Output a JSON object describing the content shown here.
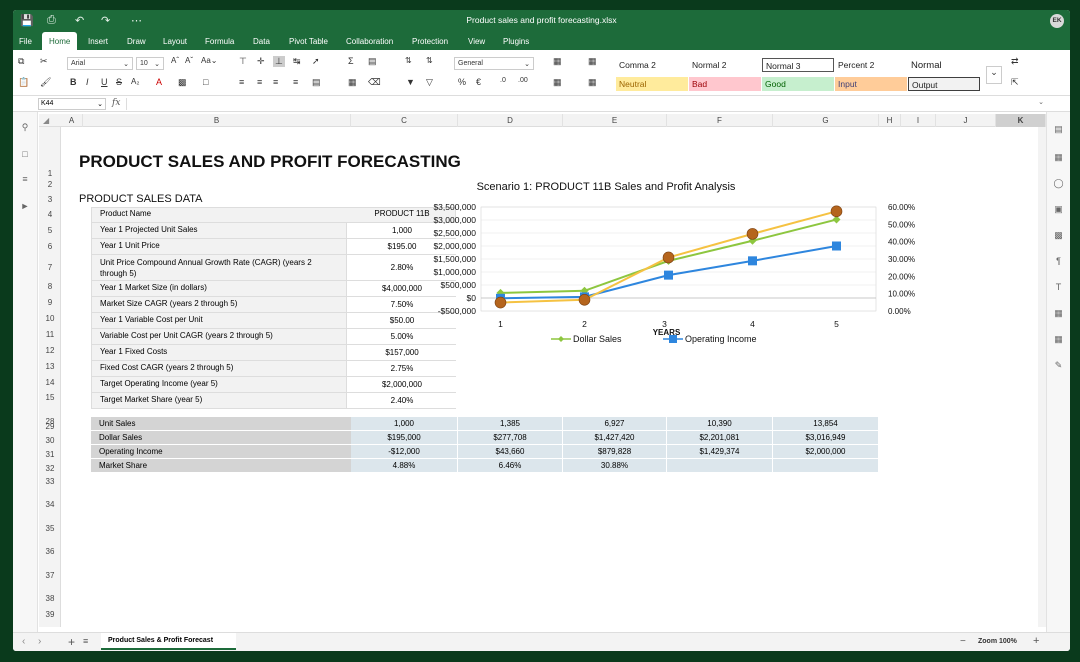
{
  "window": {
    "title": "Product sales and profit forecasting.xlsx",
    "avatar": "EK"
  },
  "menu": {
    "tabs": [
      "File",
      "Home",
      "Insert",
      "Draw",
      "Layout",
      "Formula",
      "Data",
      "Pivot Table",
      "Collaboration",
      "Protection",
      "View",
      "Plugins"
    ],
    "active": "Home"
  },
  "ribbon": {
    "font": "Arial",
    "size": "10",
    "number_format": "General",
    "styles_top": [
      "Comma 2",
      "Normal 2",
      "Normal 3",
      "Percent 2",
      "Normal"
    ],
    "styles_bottom": [
      "Neutral",
      "Bad",
      "Good",
      "Input",
      "Output"
    ],
    "style_colors": {
      "Neutral": "#ffeb9c",
      "Bad": "#ffc7ce",
      "Good": "#c6efce",
      "Input": "#ffcc99",
      "Output": "#f2f2f2"
    }
  },
  "formula_bar": {
    "cell_ref": "K44",
    "fx": "fx",
    "value": ""
  },
  "columns": [
    "A",
    "B",
    "C",
    "D",
    "E",
    "F",
    "G",
    "H",
    "I",
    "J",
    "K"
  ],
  "rows": [
    "1",
    "2",
    "3",
    "4",
    "5",
    "6",
    "7",
    "8",
    "9",
    "10",
    "11",
    "12",
    "13",
    "14",
    "15",
    "28",
    "29",
    "30",
    "31",
    "32",
    "33",
    "34",
    "35",
    "36",
    "37",
    "38",
    "39"
  ],
  "sheet": {
    "title": "PRODUCT SALES AND PROFIT FORECASTING",
    "section": "PRODUCT SALES DATA",
    "table_header": {
      "label": "Product Name",
      "value": "PRODUCT 11B"
    },
    "inputs": [
      {
        "label": "Year 1 Projected Unit Sales",
        "value": "1,000"
      },
      {
        "label": "Year 1 Unit Price",
        "value": "$195.00"
      },
      {
        "label": "Unit Price Compound Annual Growth Rate (CAGR) (years 2",
        "label2": "through 5)",
        "value": "2.80%"
      },
      {
        "label": "Year 1 Market Size (in dollars)",
        "value": "$4,000,000"
      },
      {
        "label": "Market Size CAGR (years 2 through 5)",
        "value": "7.50%"
      },
      {
        "label": "Year 1 Variable Cost per Unit",
        "value": "$50.00"
      },
      {
        "label": "Variable Cost per Unit CAGR (years 2 through 5)",
        "value": "5.00%"
      },
      {
        "label": "Year 1 Fixed Costs",
        "value": "$157,000"
      },
      {
        "label": "Fixed Cost CAGR (years 2 through 5)",
        "value": "2.75%"
      },
      {
        "label": "Target Operating Income (year 5)",
        "value": "$2,000,000"
      },
      {
        "label": "Target Market Share (year 5)",
        "value": "2.40%"
      }
    ],
    "summary": [
      {
        "label": "Unit Sales",
        "values": [
          "1,000",
          "1,385",
          "6,927",
          "10,390",
          "13,854"
        ]
      },
      {
        "label": "Dollar Sales",
        "values": [
          "$195,000",
          "$277,708",
          "$1,427,420",
          "$2,201,081",
          "$3,016,949"
        ]
      },
      {
        "label": "Operating Income",
        "values": [
          "-$12,000",
          "$43,660",
          "$879,828",
          "$1,429,374",
          "$2,000,000"
        ]
      },
      {
        "label": "Market Share",
        "values": [
          "4.88%",
          "6.46%",
          "30.88%",
          "",
          ""
        ]
      }
    ]
  },
  "chart_data": {
    "type": "line",
    "title": "Scenario 1: PRODUCT 11B Sales and Profit Analysis",
    "xlabel": "YEARS",
    "categories": [
      "1",
      "2",
      "3",
      "4",
      "5"
    ],
    "y_ticks": [
      "$3,500,000",
      "$3,000,000",
      "$2,500,000",
      "$2,000,000",
      "$1,500,000",
      "$1,000,000",
      "$500,000",
      "$0",
      "-$500,000"
    ],
    "y2_ticks": [
      "60.00%",
      "50.00%",
      "40.00%",
      "30.00%",
      "20.00%",
      "10.00%",
      "0.00%"
    ],
    "ylim": [
      -500000,
      3500000
    ],
    "y2lim": [
      0,
      60
    ],
    "series": [
      {
        "name": "Dollar Sales",
        "values": [
          195000,
          277708,
          1427420,
          2201081,
          3016949
        ],
        "color": "#8dc63f"
      },
      {
        "name": "Operating Income",
        "values": [
          -12000,
          43660,
          879828,
          1429374,
          2000000
        ],
        "color": "#2e86de"
      },
      {
        "values": [
          4.88,
          6.46,
          30.88,
          44.5,
          57.5
        ],
        "color": "#b5651d",
        "line": "#f5c242",
        "axis": "secondary"
      }
    ],
    "legend": "bottom"
  },
  "sheet_tab": "Product Sales & Profit Forecast",
  "zoom": "Zoom 100%"
}
